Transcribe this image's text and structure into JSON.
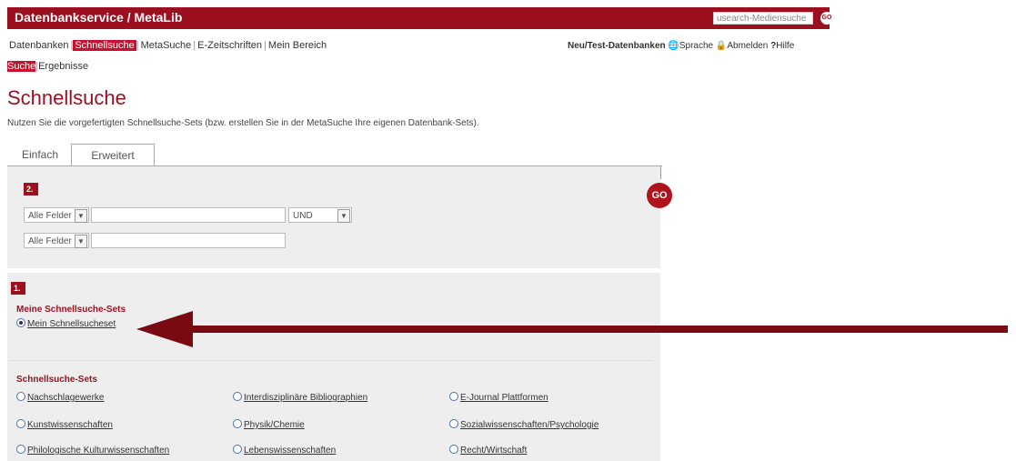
{
  "header": {
    "app_title": "Datenbankservice / MetaLib",
    "search_placeholder": "usearch-Mediensuche",
    "search_go": "GO"
  },
  "nav": {
    "items": [
      "Datenbanken",
      "Schnellsuche",
      "MetaSuche",
      "E-Zeitschriften",
      "Mein Bereich"
    ],
    "active": "Schnellsuche"
  },
  "topright": {
    "new_db": "Neu/Test-Datenbanken",
    "sprache": "Sprache",
    "abmelden": "Abmelden",
    "hilfe": "Hilfe"
  },
  "subnav": {
    "suche": "Suche",
    "ergebnisse": "Ergebnisse"
  },
  "page": {
    "title": "Schnellsuche",
    "intro": "Nutzen Sie die vorgefertigten Schnellsuche-Sets (bzw. erstellen Sie in der MetaSuche Ihre eigenen Datenbank-Sets)."
  },
  "tabs": {
    "einfach": "Einfach",
    "erweitert": "Erweitert"
  },
  "search_form": {
    "step": "2.",
    "field1": "Alle Felder",
    "field2": "Alle Felder",
    "operator": "UND",
    "go": "GO"
  },
  "sets": {
    "step": "1.",
    "meine_title": "Meine Schnellsuche-Sets",
    "meine_item": "Mein Schnellsucheset",
    "sets_title": "Schnellsuche-Sets",
    "col1": [
      "Nachschlagewerke",
      "Kunstwissenschaften",
      "Philologische Kulturwissenschaften"
    ],
    "col2": [
      "Interdisziplinäre Bibliographien",
      "Physik/Chemie",
      "Lebenswissenschaften"
    ],
    "col3": [
      "E-Journal Plattformen",
      "Sozialwissenschaften/Psychologie",
      "Recht/Wirtschaft"
    ]
  },
  "colors": {
    "brand": "#9b0f1e",
    "accent": "#c8102e",
    "arrow": "#7a0a12"
  }
}
